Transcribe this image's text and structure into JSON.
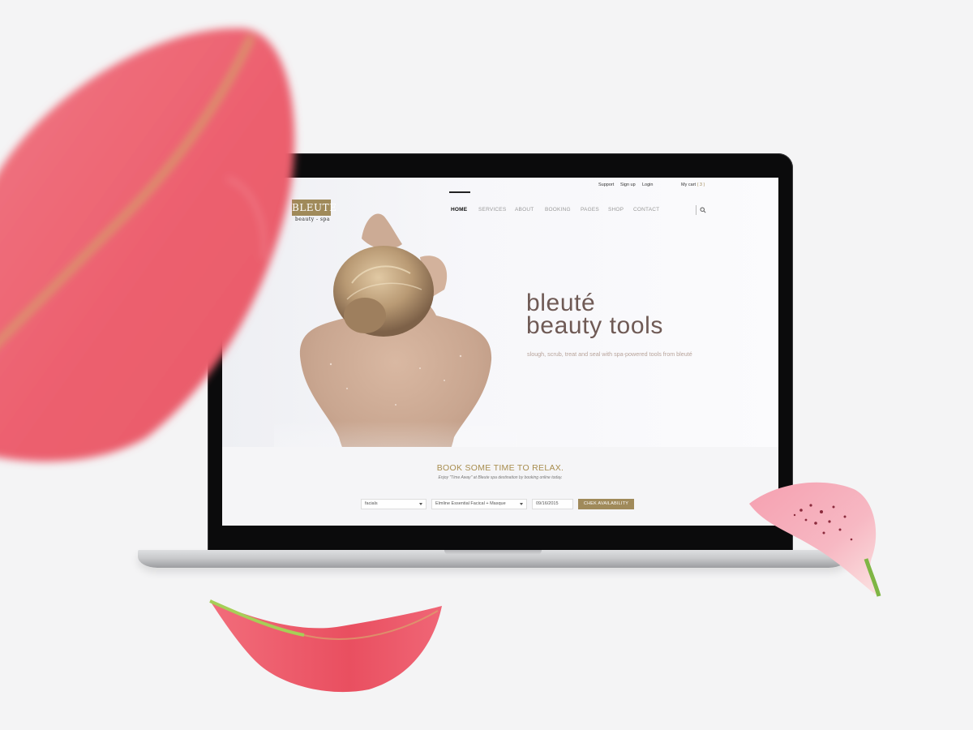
{
  "topbar": {
    "links": [
      "Support",
      "Sign up",
      "Login"
    ],
    "cart_label": "My cart",
    "cart_count": "( 3 )"
  },
  "logo": {
    "mark": "BLEUTE",
    "tagline": "beauty - spa"
  },
  "nav": {
    "items": [
      "HOME",
      "SERVICES",
      "ABOUT",
      "BOOKING",
      "PAGES",
      "SHOP",
      "CONTACT"
    ],
    "active": "HOME"
  },
  "hero": {
    "title_line1": "bleuté",
    "title_line2": "beauty tools",
    "subtitle": "slough, scrub, treat and seal with spa-powered tools from bleuté"
  },
  "booking": {
    "title": "BOOK SOME TIME TO RELAX.",
    "subtitle": "Enjoy \"Time Away\" at Bleute spa destination by booking online today.",
    "category_value": "facials",
    "service_value": "Elmline Essential Facical + Masque",
    "date_value": "09/16/2015",
    "button_label": "CHEK AVAILABILITY"
  },
  "colors": {
    "accent_gold": "#a08a5a",
    "title_brown": "#6f5a55",
    "petal_red": "#ee5d6c",
    "petal_pink": "#f6a2b2"
  },
  "icons": [
    "search-icon",
    "dropdown-caret-icon"
  ]
}
